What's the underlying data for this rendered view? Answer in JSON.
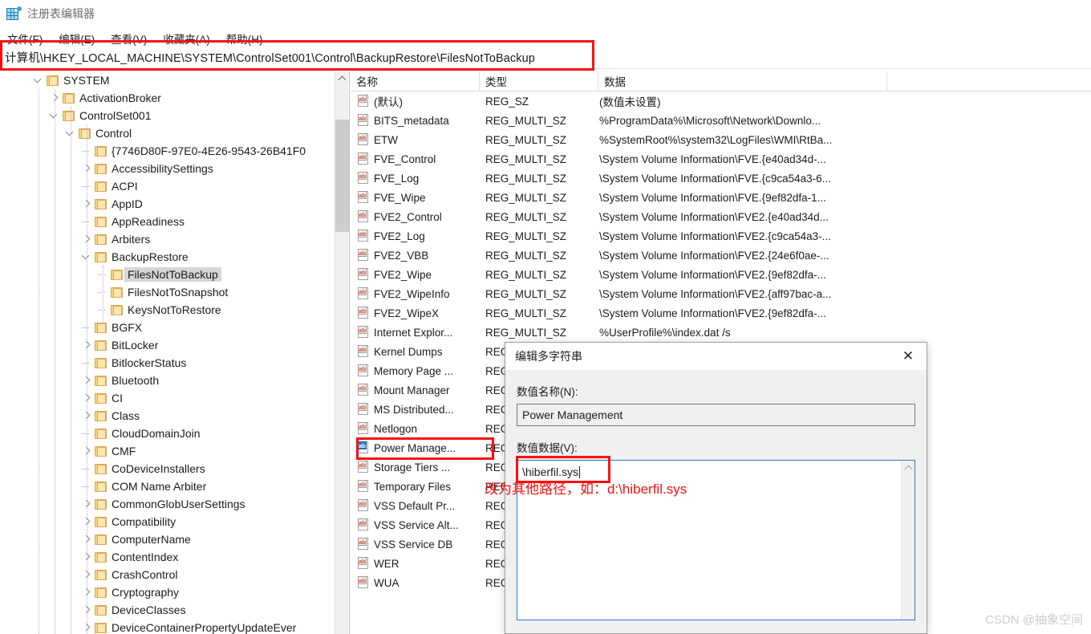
{
  "window": {
    "title": "注册表编辑器",
    "icon": "registry-editor-icon"
  },
  "menubar": {
    "items": [
      {
        "label": "文件(F)"
      },
      {
        "label": "编辑(E)"
      },
      {
        "label": "查看(V)"
      },
      {
        "label": "收藏夹(A)"
      },
      {
        "label": "帮助(H)"
      }
    ]
  },
  "address": {
    "path": "计算机\\HKEY_LOCAL_MACHINE\\SYSTEM\\ControlSet001\\Control\\BackupRestore\\FilesNotToBackup"
  },
  "tree": {
    "items": [
      {
        "label": "SYSTEM",
        "depth": 1,
        "state": "expanded"
      },
      {
        "label": "ActivationBroker",
        "depth": 2,
        "state": "collapsed"
      },
      {
        "label": "ControlSet001",
        "depth": 2,
        "state": "expanded"
      },
      {
        "label": "Control",
        "depth": 3,
        "state": "expanded"
      },
      {
        "label": "{7746D80F-97E0-4E26-9543-26B41F0",
        "depth": 4,
        "state": "leaf"
      },
      {
        "label": "AccessibilitySettings",
        "depth": 4,
        "state": "collapsed"
      },
      {
        "label": "ACPI",
        "depth": 4,
        "state": "leaf"
      },
      {
        "label": "AppID",
        "depth": 4,
        "state": "collapsed"
      },
      {
        "label": "AppReadiness",
        "depth": 4,
        "state": "leaf"
      },
      {
        "label": "Arbiters",
        "depth": 4,
        "state": "collapsed"
      },
      {
        "label": "BackupRestore",
        "depth": 4,
        "state": "expanded"
      },
      {
        "label": "FilesNotToBackup",
        "depth": 5,
        "state": "leaf",
        "selected": true
      },
      {
        "label": "FilesNotToSnapshot",
        "depth": 5,
        "state": "leaf"
      },
      {
        "label": "KeysNotToRestore",
        "depth": 5,
        "state": "leaf"
      },
      {
        "label": "BGFX",
        "depth": 4,
        "state": "leaf"
      },
      {
        "label": "BitLocker",
        "depth": 4,
        "state": "collapsed"
      },
      {
        "label": "BitlockerStatus",
        "depth": 4,
        "state": "leaf"
      },
      {
        "label": "Bluetooth",
        "depth": 4,
        "state": "collapsed"
      },
      {
        "label": "CI",
        "depth": 4,
        "state": "collapsed"
      },
      {
        "label": "Class",
        "depth": 4,
        "state": "collapsed"
      },
      {
        "label": "CloudDomainJoin",
        "depth": 4,
        "state": "leaf"
      },
      {
        "label": "CMF",
        "depth": 4,
        "state": "collapsed"
      },
      {
        "label": "CoDeviceInstallers",
        "depth": 4,
        "state": "leaf"
      },
      {
        "label": "COM Name Arbiter",
        "depth": 4,
        "state": "leaf"
      },
      {
        "label": "CommonGlobUserSettings",
        "depth": 4,
        "state": "collapsed"
      },
      {
        "label": "Compatibility",
        "depth": 4,
        "state": "collapsed"
      },
      {
        "label": "ComputerName",
        "depth": 4,
        "state": "collapsed"
      },
      {
        "label": "ContentIndex",
        "depth": 4,
        "state": "collapsed"
      },
      {
        "label": "CrashControl",
        "depth": 4,
        "state": "collapsed"
      },
      {
        "label": "Cryptography",
        "depth": 4,
        "state": "collapsed"
      },
      {
        "label": "DeviceClasses",
        "depth": 4,
        "state": "collapsed"
      },
      {
        "label": "DeviceContainerPropertyUpdateEver",
        "depth": 4,
        "state": "collapsed"
      }
    ]
  },
  "list": {
    "columns": [
      {
        "label": "名称"
      },
      {
        "label": "类型"
      },
      {
        "label": "数据"
      }
    ],
    "rows": [
      {
        "name": "(默认)",
        "type": "REG_SZ",
        "data": "(数值未设置)"
      },
      {
        "name": "BITS_metadata",
        "type": "REG_MULTI_SZ",
        "data": "%ProgramData%\\Microsoft\\Network\\Downlo..."
      },
      {
        "name": "ETW",
        "type": "REG_MULTI_SZ",
        "data": "%SystemRoot%\\system32\\LogFiles\\WMI\\RtBa..."
      },
      {
        "name": "FVE_Control",
        "type": "REG_MULTI_SZ",
        "data": "\\System Volume Information\\FVE.{e40ad34d-..."
      },
      {
        "name": "FVE_Log",
        "type": "REG_MULTI_SZ",
        "data": "\\System Volume Information\\FVE.{c9ca54a3-6..."
      },
      {
        "name": "FVE_Wipe",
        "type": "REG_MULTI_SZ",
        "data": "\\System Volume Information\\FVE.{9ef82dfa-1..."
      },
      {
        "name": "FVE2_Control",
        "type": "REG_MULTI_SZ",
        "data": "\\System Volume Information\\FVE2.{e40ad34d..."
      },
      {
        "name": "FVE2_Log",
        "type": "REG_MULTI_SZ",
        "data": "\\System Volume Information\\FVE2.{c9ca54a3-..."
      },
      {
        "name": "FVE2_VBB",
        "type": "REG_MULTI_SZ",
        "data": "\\System Volume Information\\FVE2.{24e6f0ae-..."
      },
      {
        "name": "FVE2_Wipe",
        "type": "REG_MULTI_SZ",
        "data": "\\System Volume Information\\FVE2.{9ef82dfa-..."
      },
      {
        "name": "FVE2_WipeInfo",
        "type": "REG_MULTI_SZ",
        "data": "\\System Volume Information\\FVE2.{aff97bac-a..."
      },
      {
        "name": "FVE2_WipeX",
        "type": "REG_MULTI_SZ",
        "data": "\\System Volume Information\\FVE2.{9ef82dfa-..."
      },
      {
        "name": "Internet Explor...",
        "type": "REG_MULTI_SZ",
        "data": "%UserProfile%\\index.dat /s"
      },
      {
        "name": "Kernel Dumps",
        "type": "REG",
        "data": ""
      },
      {
        "name": "Memory Page ...",
        "type": "REG",
        "data": ""
      },
      {
        "name": "Mount Manager",
        "type": "REG",
        "data": ""
      },
      {
        "name": "MS Distributed...",
        "type": "REG",
        "data": ""
      },
      {
        "name": "Netlogon",
        "type": "REG",
        "data": ""
      },
      {
        "name": "Power Manage...",
        "type": "REG",
        "data": "",
        "selected": true
      },
      {
        "name": "Storage Tiers ...",
        "type": "REG",
        "data": ""
      },
      {
        "name": "Temporary Files",
        "type": "REG",
        "data": ""
      },
      {
        "name": "VSS Default Pr...",
        "type": "REG",
        "data": ""
      },
      {
        "name": "VSS Service Alt...",
        "type": "REG",
        "data": ""
      },
      {
        "name": "VSS Service DB",
        "type": "REG",
        "data": ""
      },
      {
        "name": "WER",
        "type": "REG",
        "data": ""
      },
      {
        "name": "WUA",
        "type": "REG",
        "data": ""
      }
    ]
  },
  "dialog": {
    "title": "编辑多字符串",
    "close_label": "✕",
    "name_label": "数值名称(N):",
    "name_value": "Power Management",
    "data_label": "数值数据(V):",
    "data_value": "\\hiberfil.sys"
  },
  "annotation": {
    "text": "改为其他路径，如：d:\\hiberfil.sys",
    "color": "#fb0f0f"
  },
  "watermark": {
    "text": "CSDN @抽象空间"
  }
}
